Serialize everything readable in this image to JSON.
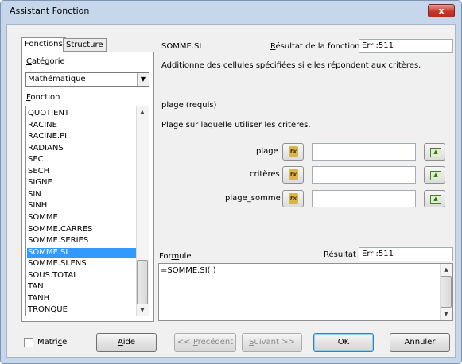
{
  "window": {
    "title": "Assistant Fonction",
    "close_label": "x"
  },
  "tabs": [
    {
      "label": "Fonctions",
      "active": true
    },
    {
      "label": "Structure",
      "active": false
    }
  ],
  "category": {
    "label": "Catégorie",
    "value": "Mathématique"
  },
  "function_label": "Fonction",
  "functions": [
    "QUOTIENT",
    "RACINE",
    "RACINE.PI",
    "RADIANS",
    "SEC",
    "SECH",
    "SIGNE",
    "SIN",
    "SINH",
    "SOMME",
    "SOMME.CARRES",
    "SOMME.SERIES",
    "SOMME.SI",
    "SOMME.SI.ENS",
    "SOUS.TOTAL",
    "TAN",
    "TANH",
    "TRONQUE"
  ],
  "selected_function": "SOMME.SI",
  "header": {
    "function_name": "SOMME.SI",
    "result_label": "Résultat de la fonction",
    "result_value": "Err :511"
  },
  "description": "Additionne des cellules spécifiées si elles répondent aux critères.",
  "argument": {
    "title": "plage (requis)",
    "help": "Plage sur laquelle utiliser les critères."
  },
  "params": [
    {
      "label": "plage",
      "value": ""
    },
    {
      "label": "critères",
      "value": ""
    },
    {
      "label": "plage_somme",
      "value": ""
    }
  ],
  "fx_icon": "function-wizard-icon",
  "shrink_icon": "shrink-dialog-icon",
  "formula": {
    "label": "Formule",
    "result_label": "Résultat",
    "result_value": "Err :511",
    "text": "=SOMME.SI( )"
  },
  "buttons": {
    "matrix": "Matrice",
    "help": "Aide",
    "previous": "<< Précédent",
    "next": "Suivant >>",
    "ok": "OK",
    "cancel": "Annuler"
  },
  "colors": {
    "selection": "#3399ff",
    "titlebar": "#c6d7ec",
    "close": "#c8382a"
  }
}
